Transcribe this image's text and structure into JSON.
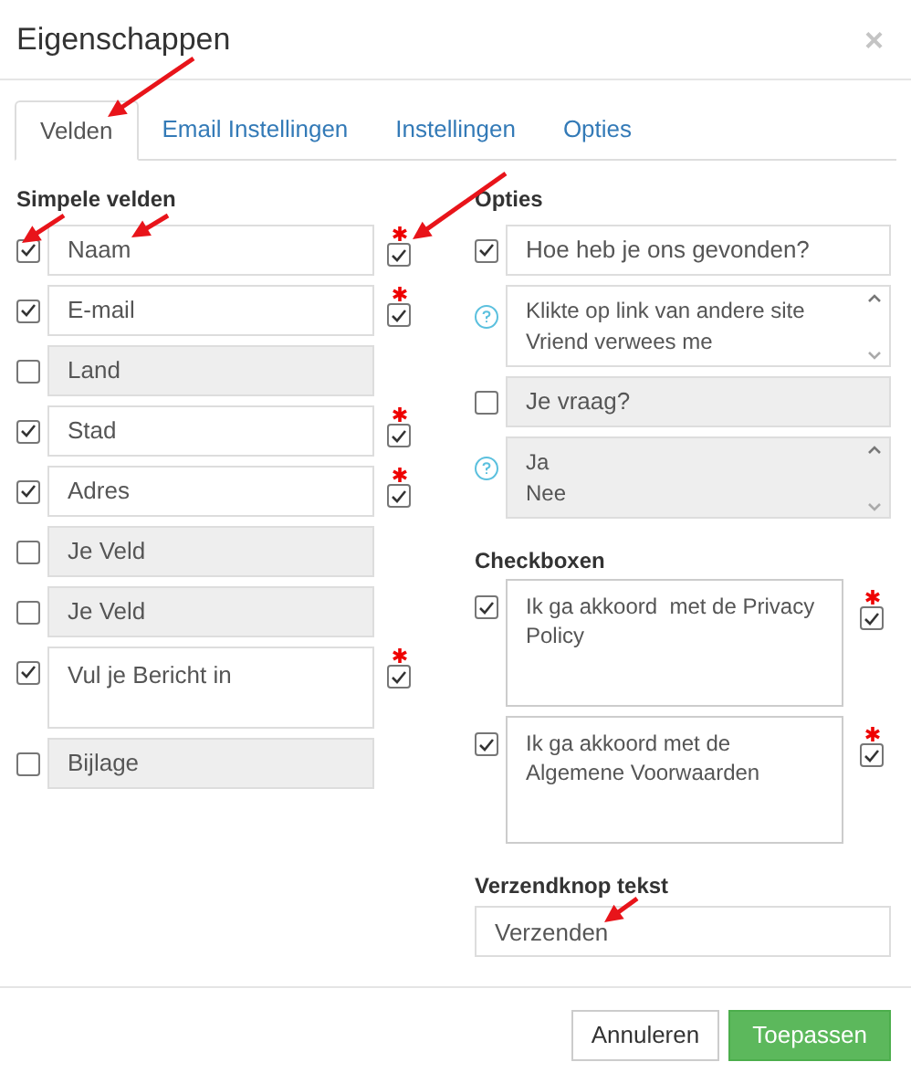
{
  "dialog": {
    "title": "Eigenschappen",
    "close": "×"
  },
  "tabs": [
    {
      "label": "Velden",
      "selected": true
    },
    {
      "label": "Email Instellingen",
      "selected": false
    },
    {
      "label": "Instellingen",
      "selected": false
    },
    {
      "label": "Opties",
      "selected": false
    }
  ],
  "simple_fields": {
    "heading": "Simpele velden",
    "items": [
      {
        "label": "Naam",
        "checked": true,
        "required": true,
        "kind": "input"
      },
      {
        "label": "E-mail",
        "checked": true,
        "required": true,
        "kind": "input"
      },
      {
        "label": "Land",
        "checked": false,
        "required": false,
        "kind": "input"
      },
      {
        "label": "Stad",
        "checked": true,
        "required": true,
        "kind": "input"
      },
      {
        "label": "Adres",
        "checked": true,
        "required": true,
        "kind": "input"
      },
      {
        "label": "Je Veld",
        "checked": false,
        "required": false,
        "kind": "input"
      },
      {
        "label": "Je Veld",
        "checked": false,
        "required": false,
        "kind": "input"
      },
      {
        "label": "Vul je Bericht in",
        "checked": true,
        "required": true,
        "kind": "textarea"
      },
      {
        "label": "Bijlage",
        "checked": false,
        "required": false,
        "kind": "input"
      }
    ]
  },
  "options": {
    "heading": "Opties",
    "items": [
      {
        "kind": "question",
        "label": "Hoe heb je ons gevonden?",
        "checked": true
      },
      {
        "kind": "choices",
        "lines": [
          "Klikte op link van andere site",
          "Vriend verwees me"
        ],
        "disabled": false
      },
      {
        "kind": "question",
        "label": "Je vraag?",
        "checked": false
      },
      {
        "kind": "choices",
        "lines": [
          "Ja",
          "Nee"
        ],
        "disabled": true
      }
    ]
  },
  "checkboxes": {
    "heading": "Checkboxen",
    "items": [
      {
        "label": "Ik ga akkoord  met de Privacy Policy",
        "checked": true,
        "required": true
      },
      {
        "label": "Ik ga akkoord met de Algemene Voorwaarden",
        "checked": true,
        "required": true
      }
    ]
  },
  "submit_text": {
    "heading": "Verzendknop tekst",
    "value": "Verzenden"
  },
  "buttons": [
    {
      "label": "Annuleren",
      "kind": "default"
    },
    {
      "label": "Toepassen",
      "kind": "primary"
    }
  ]
}
